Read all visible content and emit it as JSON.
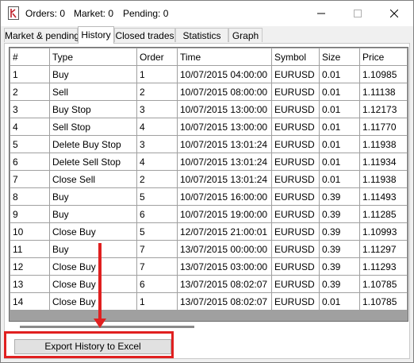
{
  "title": {
    "orders_label": "Orders: 0",
    "market_label": "Market: 0",
    "pending_label": "Pending: 0"
  },
  "tabs": [
    {
      "label": "Market & pending"
    },
    {
      "label": "History"
    },
    {
      "label": "Closed trades"
    },
    {
      "label": "Statistics"
    },
    {
      "label": "Graph"
    }
  ],
  "active_tab": "History",
  "table": {
    "columns": [
      "#",
      "Type",
      "Order",
      "Time",
      "Symbol",
      "Size",
      "Price"
    ],
    "rows": [
      [
        "1",
        "Buy",
        "1",
        "10/07/2015 04:00:00",
        "EURUSD",
        "0.01",
        "1.10985"
      ],
      [
        "2",
        "Sell",
        "2",
        "10/07/2015 08:00:00",
        "EURUSD",
        "0.01",
        "1.11138"
      ],
      [
        "3",
        "Buy Stop",
        "3",
        "10/07/2015 13:00:00",
        "EURUSD",
        "0.01",
        "1.12173"
      ],
      [
        "4",
        "Sell Stop",
        "4",
        "10/07/2015 13:00:00",
        "EURUSD",
        "0.01",
        "1.11770"
      ],
      [
        "5",
        "Delete Buy Stop",
        "3",
        "10/07/2015 13:01:24",
        "EURUSD",
        "0.01",
        "1.11938"
      ],
      [
        "6",
        "Delete Sell Stop",
        "4",
        "10/07/2015 13:01:24",
        "EURUSD",
        "0.01",
        "1.11934"
      ],
      [
        "7",
        "Close Sell",
        "2",
        "10/07/2015 13:01:24",
        "EURUSD",
        "0.01",
        "1.11938"
      ],
      [
        "8",
        "Buy",
        "5",
        "10/07/2015 16:00:00",
        "EURUSD",
        "0.39",
        "1.11493"
      ],
      [
        "9",
        "Buy",
        "6",
        "10/07/2015 19:00:00",
        "EURUSD",
        "0.39",
        "1.11285"
      ],
      [
        "10",
        "Close Buy",
        "5",
        "12/07/2015 21:00:01",
        "EURUSD",
        "0.39",
        "1.10993"
      ],
      [
        "11",
        "Buy",
        "7",
        "13/07/2015 00:00:00",
        "EURUSD",
        "0.39",
        "1.11297"
      ],
      [
        "12",
        "Close Buy",
        "7",
        "13/07/2015 03:00:00",
        "EURUSD",
        "0.39",
        "1.11293"
      ],
      [
        "13",
        "Close Buy",
        "6",
        "13/07/2015 08:02:07",
        "EURUSD",
        "0.39",
        "1.10785"
      ],
      [
        "14",
        "Close Buy",
        "1",
        "13/07/2015 08:02:07",
        "EURUSD",
        "0.01",
        "1.10785"
      ]
    ]
  },
  "export_button": {
    "label": "Export History to Excel"
  },
  "colors": {
    "highlight": "#e02020"
  },
  "icons": {
    "app": "app-icon",
    "minimize": "minimize-icon",
    "maximize": "maximize-icon",
    "close": "close-icon"
  }
}
